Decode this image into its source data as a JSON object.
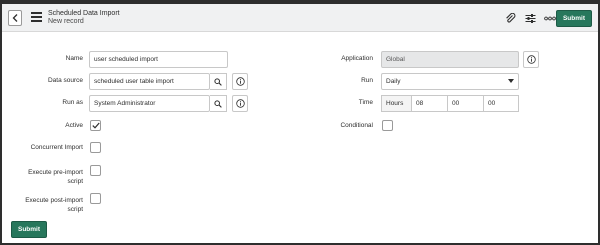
{
  "header": {
    "title": "Scheduled Data Import",
    "subtitle": "New record",
    "submit_label": "Submit",
    "icons": [
      "back-icon",
      "menu-icon",
      "paperclip-icon",
      "settings-sliders-icon",
      "more-icon"
    ]
  },
  "form": {
    "name_label": "Name",
    "name_value": "user scheduled import",
    "datasource_label": "Data source",
    "datasource_value": "scheduled user table import",
    "runas_label": "Run as",
    "runas_value": "System Administrator",
    "active_label": "Active",
    "active_checked": true,
    "concurrent_label": "Concurrent Import",
    "concurrent_checked": false,
    "preimport_label_1": "Execute pre-import",
    "preimport_label_2": "script",
    "preimport_checked": false,
    "postimport_label_1": "Execute post-import",
    "postimport_label_2": "script",
    "postimport_checked": false,
    "application_label": "Application",
    "application_value": "Global",
    "run_label": "Run",
    "run_value": "Daily",
    "time_label": "Time",
    "time_hours_label": "Hours",
    "time_hours": "08",
    "time_minutes": "00",
    "time_seconds": "00",
    "conditional_label": "Conditional",
    "conditional_checked": false
  },
  "footer": {
    "submit_label": "Submit"
  },
  "colors": {
    "accent": "#27775c",
    "header_bg": "#f0f1f2",
    "readonly_bg": "#e6e7e8"
  }
}
